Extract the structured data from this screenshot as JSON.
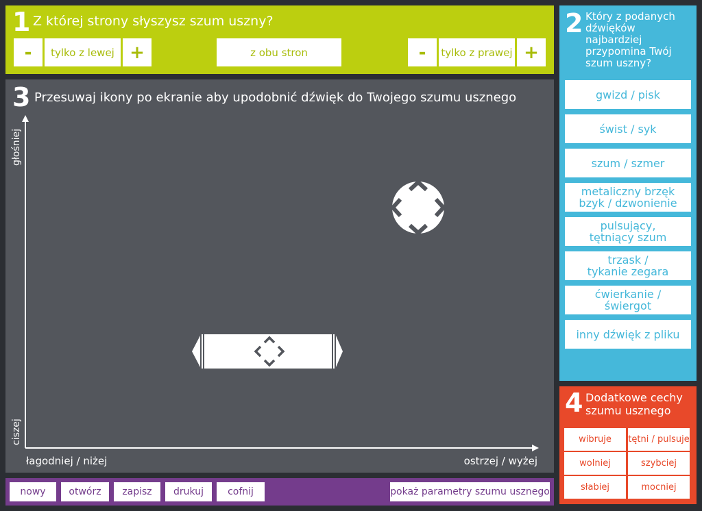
{
  "section1": {
    "number": "1",
    "title": "Z której strony słyszysz szum uszny?",
    "left_minus": "-",
    "left_label": "tylko z lewej",
    "left_plus": "+",
    "both_label": "z obu stron",
    "right_minus": "-",
    "right_label": "tylko z prawej",
    "right_plus": "+"
  },
  "section2": {
    "number": "2",
    "title": "Który z podanych dźwięków najbardziej przypomina Twój szum uszny?",
    "options": [
      {
        "line1": "gwizd / pisk",
        "line2": ""
      },
      {
        "line1": "świst / syk",
        "line2": ""
      },
      {
        "line1": "szum / szmer",
        "line2": ""
      },
      {
        "line1": "metaliczny brzęk",
        "line2": "bzyk / dzwonienie"
      },
      {
        "line1": "pulsujący,",
        "line2": "tętniący szum"
      },
      {
        "line1": "trzask /",
        "line2": "tykanie zegara"
      },
      {
        "line1": "ćwierkanie /",
        "line2": "świergot"
      },
      {
        "line1": "inny dźwięk z pliku",
        "line2": ""
      }
    ]
  },
  "section3": {
    "number": "3",
    "title": "Przesuwaj ikony po ekranie aby upodobnić dźwięk do Twojego szumu usznego",
    "y_top_label": "głośniej",
    "y_bottom_label": "ciszej",
    "x_left_label": "łagodniej / niżej",
    "x_right_label": "ostrzej / wyżej"
  },
  "section4": {
    "number": "4",
    "title_line1": "Dodatkowe cechy",
    "title_line2": "szumu usznego",
    "features": [
      "wibruje",
      "tętni / pulsuje",
      "wolniej",
      "szybciej",
      "słabiej",
      "mocniej"
    ]
  },
  "toolbar": {
    "new": "nowy",
    "open": "otwórz",
    "save": "zapisz",
    "print": "drukuj",
    "undo": "cofnij",
    "show_params": "pokaż parametry szumu usznego"
  },
  "colors": {
    "green": "#bccf0f",
    "blue": "#45b8da",
    "gray": "#53565c",
    "orange": "#e8492a",
    "purple": "#743c8c"
  }
}
